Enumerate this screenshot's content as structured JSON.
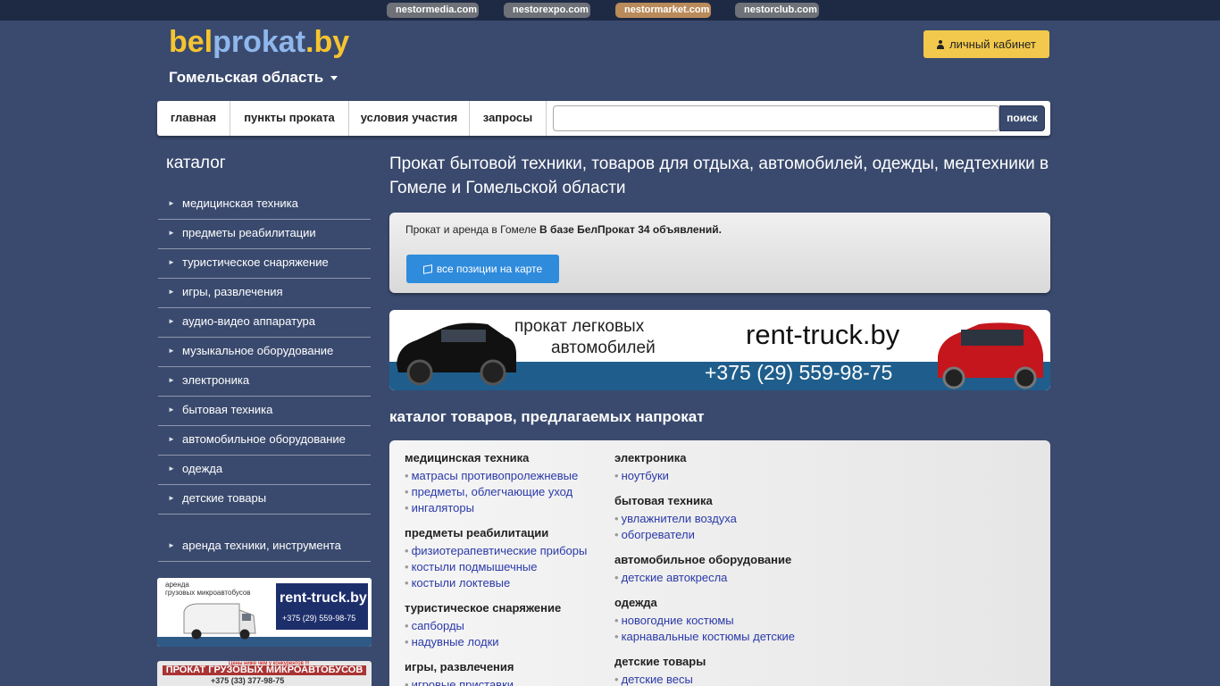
{
  "netbar": {
    "links": [
      {
        "label": "nestormedia.com"
      },
      {
        "label": "nestorexpo.com"
      },
      {
        "label": "nestormarket.com",
        "active": true
      },
      {
        "label": "nestorclub.com"
      }
    ],
    "active_color": "#b98a5a"
  },
  "header": {
    "logo_part1": "bel",
    "logo_part2": "prokat",
    "logo_part3": ".by",
    "region": "Гомельская область",
    "cabinet_label": "личный кабинет"
  },
  "nav": {
    "items": [
      {
        "label": "главная"
      },
      {
        "label": "пункты проката"
      },
      {
        "label": "условия участия"
      },
      {
        "label": "запросы"
      }
    ],
    "search_value": "",
    "search_button": "поиск"
  },
  "sidebar": {
    "title": "каталог",
    "items": [
      {
        "label": "медицинская техника"
      },
      {
        "label": "предметы реабилитации"
      },
      {
        "label": "туристическое снаряжение"
      },
      {
        "label": "игры, развлечения"
      },
      {
        "label": "аудио-видео аппаратура"
      },
      {
        "label": "музыкальное оборудование"
      },
      {
        "label": "электроника"
      },
      {
        "label": "бытовая техника"
      },
      {
        "label": "автомобильное оборудование"
      },
      {
        "label": "одежда"
      },
      {
        "label": "детские товары"
      }
    ],
    "extra_item": "аренда техники, инструмента",
    "ad1": {
      "line1": "аренда",
      "line2": "грузовых микроавтобусов",
      "brand": "rent-truck.by",
      "phone": "+375 (29) 559-98-75"
    },
    "ad2": {
      "line1": "Цены ниже чем у конкурентов !!!",
      "line2": "ПРОКАТ ГРУЗОВЫХ МИКРОАВТОБУСОВ",
      "phone": "+375 (33) 377-98-75"
    }
  },
  "main": {
    "heading": "Прокат бытовой техники, товаров для отдыха, автомобилей, одежды, медтехники в Гомеле и Гомельской области",
    "info_text": "Прокат и аренда в Гомеле",
    "info_bold": "В базе БелПрокат 34 объявлений.",
    "map_button": "все позиции на карте",
    "banner": {
      "line1": "прокат легковых",
      "line2": "автомобилей",
      "brand": "rent-truck.by",
      "phone": "+375 (29) 559-98-75"
    },
    "catalog_title": "каталог товаров, предлагаемых напрокат",
    "col1": [
      {
        "title": "медицинская техника",
        "links": [
          "матрасы противопролежневые",
          "предметы, облегчающие уход",
          "ингаляторы"
        ]
      },
      {
        "title": "предметы реабилитации",
        "links": [
          "физиотерапевтические приборы",
          "костыли подмышечные",
          "костыли локтевые"
        ]
      },
      {
        "title": "туристическое снаряжение",
        "links": [
          "сапборды",
          "надувные лодки"
        ]
      },
      {
        "title": "игры, развлечения",
        "links": [
          "игровые приставки"
        ]
      }
    ],
    "col2": [
      {
        "title": "электроника",
        "links": [
          "ноутбуки"
        ]
      },
      {
        "title": "бытовая техника",
        "links": [
          "увлажнители воздуха",
          "обогреватели"
        ]
      },
      {
        "title": "автомобильное оборудование",
        "links": [
          "детские автокресла"
        ]
      },
      {
        "title": "одежда",
        "links": [
          "новогодние костюмы",
          "карнавальные костюмы детские"
        ]
      },
      {
        "title": "детские товары",
        "links": [
          "детские весы"
        ]
      }
    ]
  }
}
